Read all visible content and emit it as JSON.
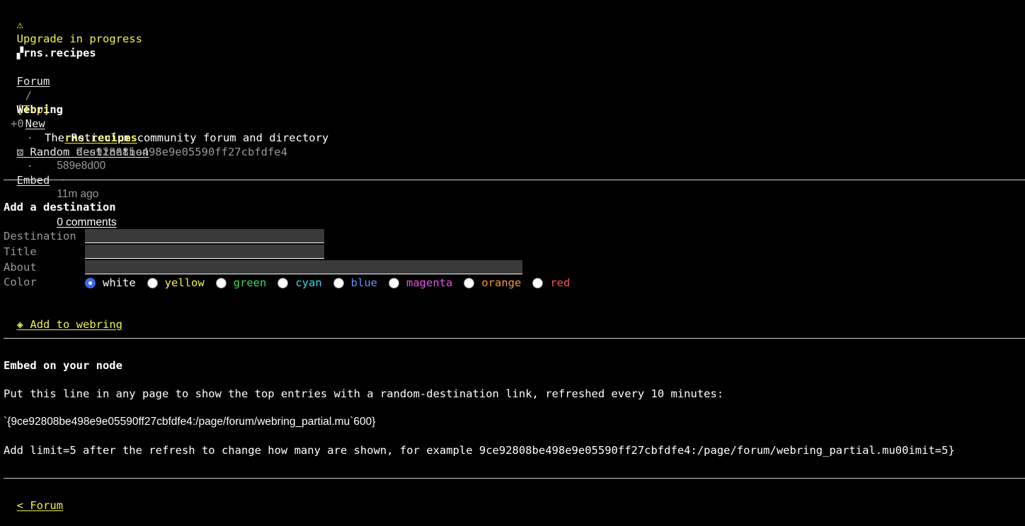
{
  "banner": {
    "icon": "⚠",
    "text": "Upgrade in progress"
  },
  "site": {
    "icon": "▞",
    "name": "rns.recipes"
  },
  "breadcrumb": {
    "parent": "Forum",
    "separator": "/",
    "current": "Webring"
  },
  "sort_nav": {
    "top": "[Top]",
    "new": "New",
    "sep": "·",
    "random_icon": "⚄",
    "random": "Random destination",
    "embed": "Embed"
  },
  "entries": [
    {
      "score": "+0",
      "title": "rns.recipes",
      "hash": "9ce92808be498e9e05590ff27cbfdfe4",
      "description": "The Reticulum community forum and directory",
      "author": "589e8d00",
      "sep": "·",
      "age": "11m ago",
      "comments": "0 comments"
    }
  ],
  "add_form": {
    "heading": "Add a destination",
    "destination_label": "Destination",
    "title_label": "Title",
    "about_label": "About",
    "color_label": "Color",
    "destination_value": "",
    "title_value": "",
    "about_value": "",
    "colors": [
      {
        "label": "white",
        "hex": "#ffffff",
        "checked": true
      },
      {
        "label": "yellow",
        "hex": "#f2f24a",
        "checked": false
      },
      {
        "label": "green",
        "hex": "#3ddc5a",
        "checked": false
      },
      {
        "label": "cyan",
        "hex": "#3ad7e6",
        "checked": false
      },
      {
        "label": "blue",
        "hex": "#6d8cf5",
        "checked": false
      },
      {
        "label": "magenta",
        "hex": "#e84ee8",
        "checked": false
      },
      {
        "label": "orange",
        "hex": "#f29a3a",
        "checked": false
      },
      {
        "label": "red",
        "hex": "#f2545b",
        "checked": false
      }
    ],
    "submit_icon": "◈",
    "submit_label": "Add to webring"
  },
  "embed": {
    "heading": "Embed on your node",
    "intro": "Put this line in any page to show the top entries with a random-destination link, refreshed every 10 minutes:",
    "code": "`{9ce92808be498e9e05590ff27cbfdfe4:/page/forum/webring_partial.mu`600}",
    "note": "Add limit=5 after the refresh to change how many are shown, for example 9ce92808be498e9e05590ff27cbfdfe4:/page/forum/webring_partial.mu00imit=5}"
  },
  "footer": {
    "back_link": "< Forum"
  }
}
